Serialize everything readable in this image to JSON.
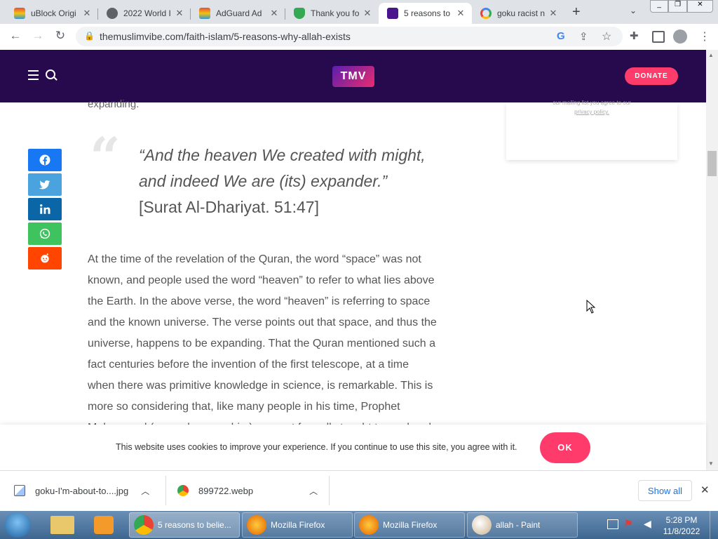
{
  "browser": {
    "tabs": [
      {
        "label": "uBlock Origi",
        "active": false
      },
      {
        "label": "2022 World I",
        "active": false
      },
      {
        "label": "AdGuard Ad",
        "active": false
      },
      {
        "label": "Thank you fo",
        "active": false
      },
      {
        "label": "5 reasons to",
        "active": true
      },
      {
        "label": "goku racist n",
        "active": false
      }
    ],
    "new_tab_label": "+",
    "url": "themuslimvibe.com/faith-islam/5-reasons-why-allah-exists"
  },
  "site": {
    "logo_text": "TMV",
    "donate_label": "DONATE"
  },
  "article": {
    "cut_off_top": "expanding.",
    "quote_italic": "“And the heaven We created with might, and indeed We are (its) expander.”",
    "quote_ref": " [Surat Al-Dhariyat. 51:47]",
    "body": "At the time of the revelation of the Quran, the word “space” was not known, and people used the word “heaven” to refer to what lies above the Earth.  In the above verse, the word “heaven” is referring to space and the known universe.  The verse points out that space, and thus the universe, happens to be expanding. That the Quran mentioned such a fact centuries before the invention of the first telescope, at a time when there was primitive knowledge in science, is remarkable. This is more so considering that, like many people in his time, Prophet Muhammad (peace be upon him) was not formally taught to read and",
    "sidecard_text": "our mailing list you agree to our",
    "sidecard_link": "privacy policy."
  },
  "share_buttons": [
    {
      "name": "facebook",
      "color": "#1877f2"
    },
    {
      "name": "twitter",
      "color": "#4aa3df"
    },
    {
      "name": "linkedin",
      "color": "#0b66a8"
    },
    {
      "name": "whatsapp",
      "color": "#3fc35f"
    },
    {
      "name": "reddit",
      "color": "#ff4500"
    }
  ],
  "cookie": {
    "text": "This website uses cookies to improve your experience. If you continue to use this site, you agree with it.",
    "ok_label": "OK"
  },
  "downloads": [
    {
      "filename": "goku-I'm-about-to....jpg"
    },
    {
      "filename": "899722.webp"
    }
  ],
  "show_all_label": "Show all",
  "taskbar": {
    "items": [
      {
        "label": "5 reasons to belie...",
        "active": true
      },
      {
        "label": "Mozilla Firefox",
        "active": false
      },
      {
        "label": "Mozilla Firefox",
        "active": false
      },
      {
        "label": "allah - Paint",
        "active": false
      }
    ],
    "time": "5:28 PM",
    "date": "11/8/2022"
  }
}
